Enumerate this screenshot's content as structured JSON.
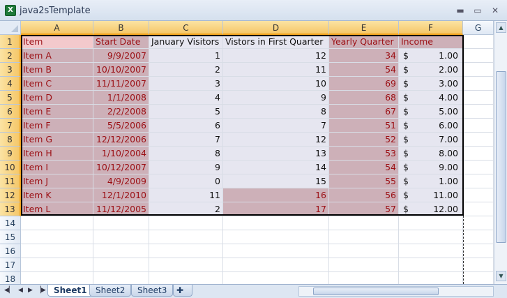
{
  "window": {
    "title": "java2sTemplate",
    "app_icon": "excel-icon"
  },
  "columns": [
    "A",
    "B",
    "C",
    "D",
    "E",
    "F",
    "G"
  ],
  "header_row": [
    "Item",
    "Start Date",
    "January Visitors",
    "Vistors in First Quarter",
    "Yearly Quarter",
    "Income"
  ],
  "rows": [
    {
      "item": "Item A",
      "date": "9/9/2007",
      "jan": "1",
      "q1": "12",
      "yq": "34",
      "cur": "$",
      "inc": "1.00"
    },
    {
      "item": "Item B",
      "date": "10/10/2007",
      "jan": "2",
      "q1": "11",
      "yq": "54",
      "cur": "$",
      "inc": "2.00"
    },
    {
      "item": "Item C",
      "date": "11/11/2007",
      "jan": "3",
      "q1": "10",
      "yq": "69",
      "cur": "$",
      "inc": "3.00"
    },
    {
      "item": "Item D",
      "date": "1/1/2008",
      "jan": "4",
      "q1": "9",
      "yq": "68",
      "cur": "$",
      "inc": "4.00"
    },
    {
      "item": "Item E",
      "date": "2/2/2008",
      "jan": "5",
      "q1": "8",
      "yq": "67",
      "cur": "$",
      "inc": "5.00"
    },
    {
      "item": "Item F",
      "date": "5/5/2006",
      "jan": "6",
      "q1": "7",
      "yq": "51",
      "cur": "$",
      "inc": "6.00"
    },
    {
      "item": "Item G",
      "date": "12/12/2006",
      "jan": "7",
      "q1": "12",
      "yq": "52",
      "cur": "$",
      "inc": "7.00"
    },
    {
      "item": "Item H",
      "date": "1/10/2004",
      "jan": "8",
      "q1": "13",
      "yq": "53",
      "cur": "$",
      "inc": "8.00"
    },
    {
      "item": "Item I",
      "date": "10/12/2007",
      "jan": "9",
      "q1": "14",
      "yq": "54",
      "cur": "$",
      "inc": "9.00"
    },
    {
      "item": "Item J",
      "date": "4/9/2009",
      "jan": "0",
      "q1": "15",
      "yq": "55",
      "cur": "$",
      "inc": "1.00"
    },
    {
      "item": "Item K",
      "date": "12/1/2010",
      "jan": "11",
      "q1": "16",
      "yq": "56",
      "cur": "$",
      "inc": "11.00"
    },
    {
      "item": "Item L",
      "date": "11/12/2005",
      "jan": "2",
      "q1": "17",
      "yq": "57",
      "cur": "$",
      "inc": "12.00"
    }
  ],
  "row_numbers": [
    "1",
    "2",
    "3",
    "4",
    "5",
    "6",
    "7",
    "8",
    "9",
    "10",
    "11",
    "12",
    "13",
    "14",
    "15",
    "16",
    "17",
    "18"
  ],
  "sheets": [
    "Sheet1",
    "Sheet2",
    "Sheet3"
  ],
  "active_sheet": "Sheet1",
  "colors": {
    "highlight_fill": "#cdb0b8",
    "highlight_text": "#9b0f14",
    "light_fill": "#e6e6f0"
  }
}
